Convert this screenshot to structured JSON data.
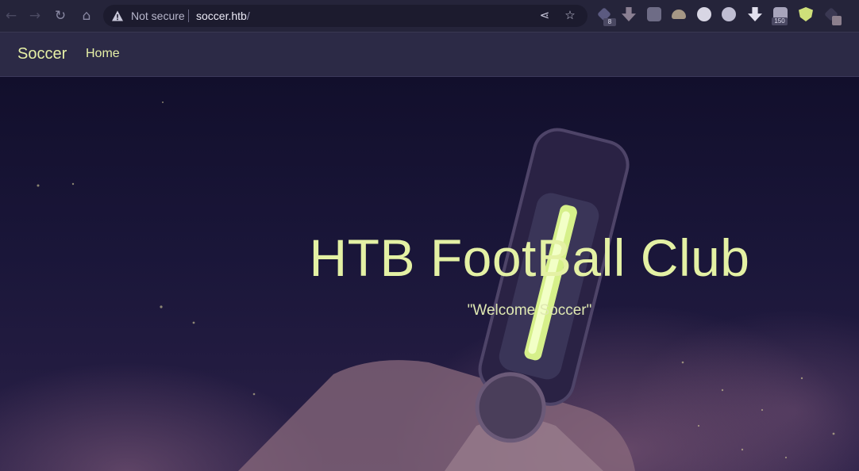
{
  "browser": {
    "security_label": "Not secure",
    "url_host": "soccer.htb",
    "url_path": "/",
    "extension_badges": [
      "8",
      "150"
    ]
  },
  "site": {
    "brand": "Soccer",
    "nav": [
      {
        "label": "Home"
      }
    ],
    "hero": {
      "title": "HTB FootBall Club",
      "subtitle": "\"Welcome Soccer\""
    }
  },
  "colors": {
    "accent": "#e4f1a4",
    "navbar": "#2c2a46",
    "background": "#15122e"
  },
  "icons": [
    "back-icon",
    "forward-icon",
    "reload-icon",
    "home-icon",
    "warning-icon",
    "share-icon",
    "bookmark-star-icon"
  ]
}
